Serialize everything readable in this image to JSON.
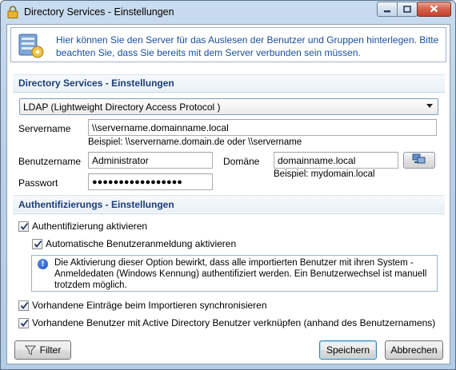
{
  "window": {
    "title": "Directory Services - Einstellungen"
  },
  "info": {
    "text": "Hier können Sie den Server für das Auslesen der Benutzer und Gruppen hinterlegen. Bitte beachten Sie, dass Sie bereits mit dem Server verbunden sein müssen."
  },
  "directory_section": {
    "title": "Directory Services - Einstellungen",
    "provider_selected": "LDAP (Lightweight Directory Access Protocol )",
    "servername_label": "Servername",
    "servername_value": "\\\\servername.domainname.local",
    "servername_hint": "Beispiel: \\\\servername.domain.de oder \\\\servername",
    "username_label": "Benutzername",
    "username_value": "Administrator",
    "domain_label": "Domäne",
    "domain_value": "domainname.local",
    "domain_hint": "Beispiel: mydomain.local",
    "password_label": "Passwort",
    "password_value": "●●●●●●●●●●●●●●●●●"
  },
  "auth_section": {
    "title": "Authentifizierungs - Einstellungen",
    "enable_auth_label": "Authentifizierung aktivieren",
    "enable_auth_checked": true,
    "auto_login_label": "Automatische Benutzeranmeldung aktivieren",
    "auto_login_checked": true,
    "notice_text": "Die Aktivierung dieser Option bewirkt, dass alle importierten Benutzer mit ihren System - Anmeldedaten (Windows Kennung) authentifiziert werden. Ein Benutzerwechsel ist manuell trotzdem möglich.",
    "sync_label": "Vorhandene Einträge beim Importieren synchronisieren",
    "sync_checked": true,
    "link_label": "Vorhandene Benutzer mit Active Directory Benutzer verknüpfen (anhand des Benutzernamens)",
    "link_checked": true
  },
  "footer": {
    "filter_label": "Filter",
    "save_label": "Speichern",
    "cancel_label": "Abbrechen"
  },
  "colors": {
    "section_title": "#1b3d78",
    "info_text": "#1a4fa0",
    "close_button": "#c6422c"
  },
  "icons": {
    "title": "lock-icon",
    "info": "server-settings-icon",
    "lookup": "network-computers-icon",
    "notice": "info-icon",
    "filter": "funnel-icon"
  }
}
